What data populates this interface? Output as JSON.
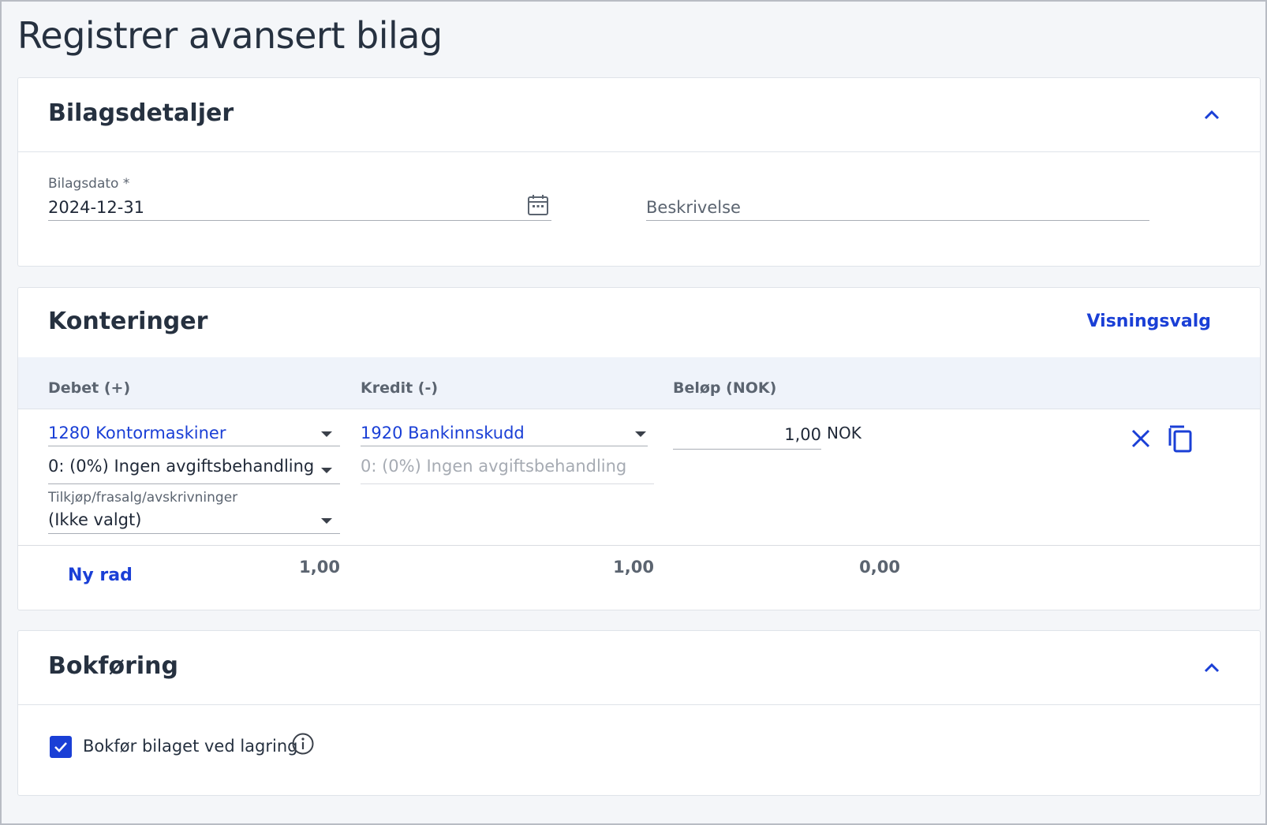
{
  "page": {
    "title": "Registrer avansert bilag"
  },
  "details": {
    "title": "Bilagsdetaljer",
    "date_label": "Bilagsdato *",
    "date_value": "2024-12-31",
    "description_placeholder": "Beskrivelse"
  },
  "postings": {
    "title": "Konteringer",
    "view_options": "Visningsvalg",
    "headers": {
      "debit": "Debet (+)",
      "credit": "Kredit (-)",
      "amount": "Beløp (NOK)"
    },
    "row": {
      "debit_account": "1280 Kontormaskiner",
      "debit_vat": "0: (0%) Ingen avgiftsbehandling",
      "acquisition_label": "Tilkjøp/frasalg/avskrivninger",
      "acquisition_value": "(Ikke valgt)",
      "credit_account": "1920 Bankinnskudd",
      "credit_vat": "0: (0%) Ingen avgiftsbehandling",
      "amount": "1,00",
      "currency": "NOK"
    },
    "new_row": "Ny rad",
    "totals": {
      "debit": "1,00",
      "credit": "1,00",
      "difference": "0,00"
    }
  },
  "booking": {
    "title": "Bokføring",
    "checkbox_label": "Bokfør bilaget ved lagring",
    "checked": true
  },
  "colors": {
    "accent": "#1a3fd6",
    "header_bg": "#eff3fa",
    "text": "#263140"
  },
  "icons": [
    "chevron-up-icon",
    "calendar-icon",
    "caret-down-icon",
    "close-icon",
    "copy-icon",
    "check-icon",
    "info-icon"
  ]
}
